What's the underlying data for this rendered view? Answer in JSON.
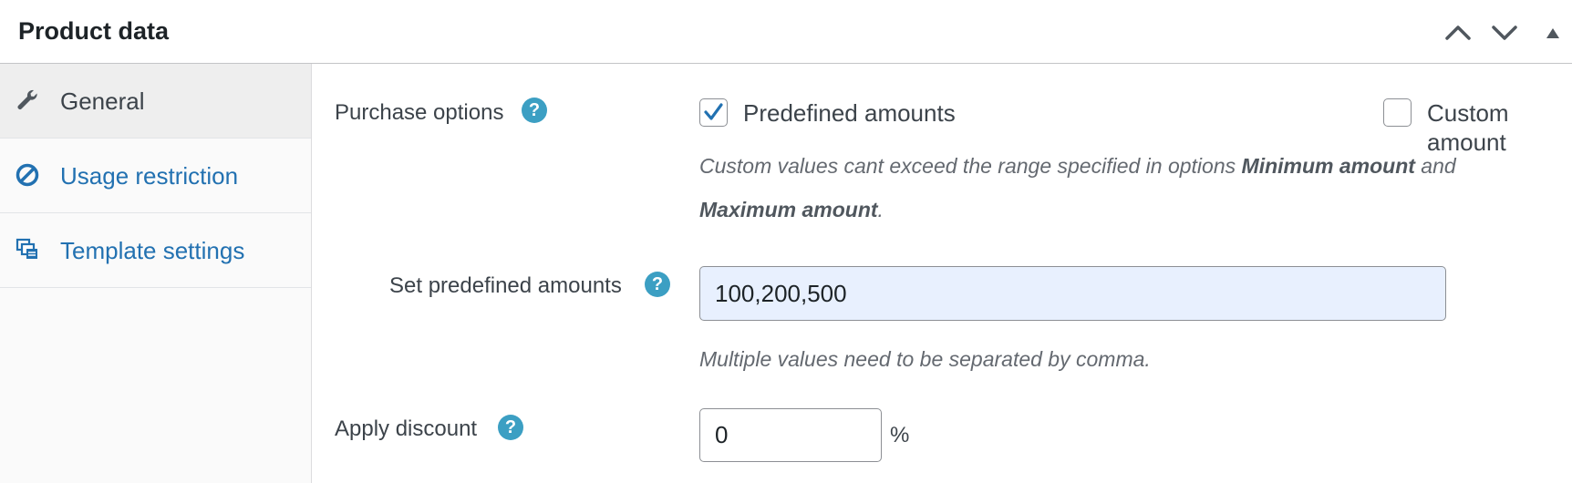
{
  "header": {
    "title": "Product data",
    "move_up_icon": "chevron-up-icon",
    "move_down_icon": "chevron-down-icon",
    "toggle_icon": "triangle-up-icon"
  },
  "sidebar": {
    "items": [
      {
        "label": "General",
        "icon": "wrench-icon",
        "active": true
      },
      {
        "label": "Usage restriction",
        "icon": "no-symbol-icon",
        "active": false
      },
      {
        "label": "Template settings",
        "icon": "template-icon",
        "active": false
      }
    ]
  },
  "main": {
    "purchase_options": {
      "label": "Purchase options",
      "help": "?",
      "predefined": {
        "label": "Predefined amounts",
        "checked": true
      },
      "custom": {
        "label": "Custom amount",
        "checked": false
      },
      "desc_part1": "Custom values cant exceed the range specified in options ",
      "desc_min": "Minimum amount",
      "desc_and": " and ",
      "desc_max": "Maximum amount",
      "desc_end": "."
    },
    "predefined_amounts": {
      "label": "Set predefined amounts",
      "help": "?",
      "value": "100,200,500",
      "desc": "Multiple values need to be separated by comma."
    },
    "discount": {
      "label": "Apply discount",
      "help": "?",
      "value": "0",
      "unit": "%"
    }
  },
  "colors": {
    "link": "#2271b1",
    "help": "#3c9fc3",
    "input_filled_bg": "#e8f0fe",
    "checkmark": "#2271b1"
  }
}
